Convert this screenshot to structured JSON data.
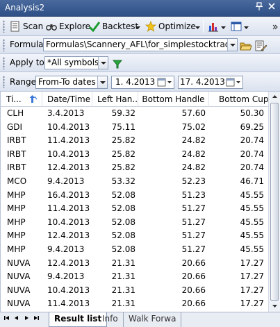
{
  "window": {
    "title": "Analysis2",
    "pin_glyph": "⨛",
    "close_glyph": "✕"
  },
  "toolbar": {
    "scan_label": "Scan",
    "explore_label": "Explore",
    "backtest_label": "Backtest",
    "optimize_label": "Optimize"
  },
  "formula": {
    "label": "Formula",
    "path": "Formulas\\Scannery_AFL\\for_simplestocktrading\\c"
  },
  "apply": {
    "label": "Apply to",
    "value": "*All symbols"
  },
  "range": {
    "label": "Range",
    "value": "From-To dates",
    "from_date": "1.  4.2013",
    "to_date": "17.  4.2013"
  },
  "table": {
    "columns": [
      "Ti...",
      "Date/Time",
      "Left Han...",
      "Bottom Handle",
      "Bottom Cup"
    ],
    "rows": [
      [
        "CLH",
        "3.4.2013",
        "59.32",
        "57.60",
        "50.30"
      ],
      [
        "GDI",
        "10.4.2013",
        "75.11",
        "75.02",
        "69.25"
      ],
      [
        "IRBT",
        "11.4.2013",
        "25.82",
        "24.82",
        "20.74"
      ],
      [
        "IRBT",
        "10.4.2013",
        "25.82",
        "24.82",
        "20.74"
      ],
      [
        "IRBT",
        "12.4.2013",
        "25.82",
        "24.82",
        "20.74"
      ],
      [
        "MCO",
        "9.4.2013",
        "53.32",
        "52.23",
        "46.71"
      ],
      [
        "MHP",
        "16.4.2013",
        "52.08",
        "51.23",
        "45.55"
      ],
      [
        "MHP",
        "11.4.2013",
        "52.08",
        "51.27",
        "45.55"
      ],
      [
        "MHP",
        "10.4.2013",
        "52.08",
        "51.27",
        "45.55"
      ],
      [
        "MHP",
        "12.4.2013",
        "52.08",
        "51.27",
        "45.55"
      ],
      [
        "MHP",
        "9.4.2013",
        "52.08",
        "51.27",
        "45.55"
      ],
      [
        "NUVA",
        "12.4.2013",
        "21.31",
        "20.66",
        "17.27"
      ],
      [
        "NUVA",
        "9.4.2013",
        "21.31",
        "20.66",
        "17.27"
      ],
      [
        "NUVA",
        "10.4.2013",
        "21.31",
        "20.66",
        "17.27"
      ],
      [
        "NUVA",
        "11.4.2013",
        "21.31",
        "20.66",
        "17.27"
      ]
    ]
  },
  "tabs": {
    "result": "Result list",
    "info": "Info",
    "walk": "Walk Forwa"
  },
  "colors": {
    "title_bar": "#2d4f86",
    "toolbar_bg": "#dbe2ef",
    "sort_arrow": "#3a78d8"
  }
}
